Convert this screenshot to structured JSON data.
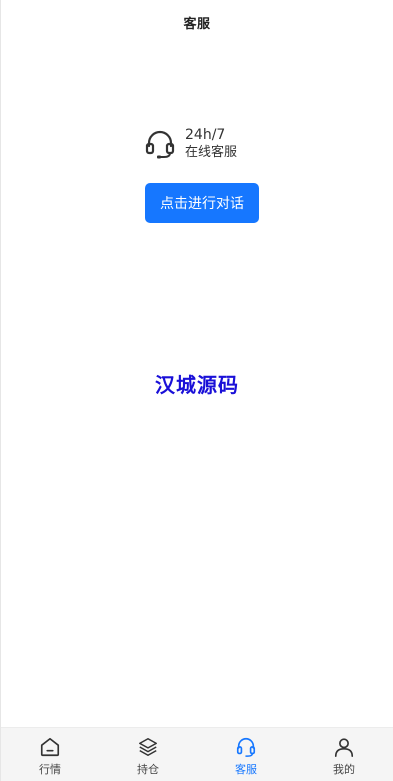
{
  "header": {
    "title": "客服"
  },
  "support": {
    "hours": "24h/7",
    "label": "在线客服",
    "icon": "headset-icon",
    "button_label": "点击进行对话"
  },
  "watermark": {
    "text": "汉城源码",
    "color": "#1a10d8"
  },
  "tabbar": {
    "items": [
      {
        "label": "行情",
        "icon": "home-icon",
        "active": false
      },
      {
        "label": "持仓",
        "icon": "layers-icon",
        "active": false
      },
      {
        "label": "客服",
        "icon": "headset-icon",
        "active": true
      },
      {
        "label": "我的",
        "icon": "user-icon",
        "active": false
      }
    ],
    "active_color": "#1677ff"
  },
  "colors": {
    "accent": "#1677ff",
    "text": "#333333"
  }
}
